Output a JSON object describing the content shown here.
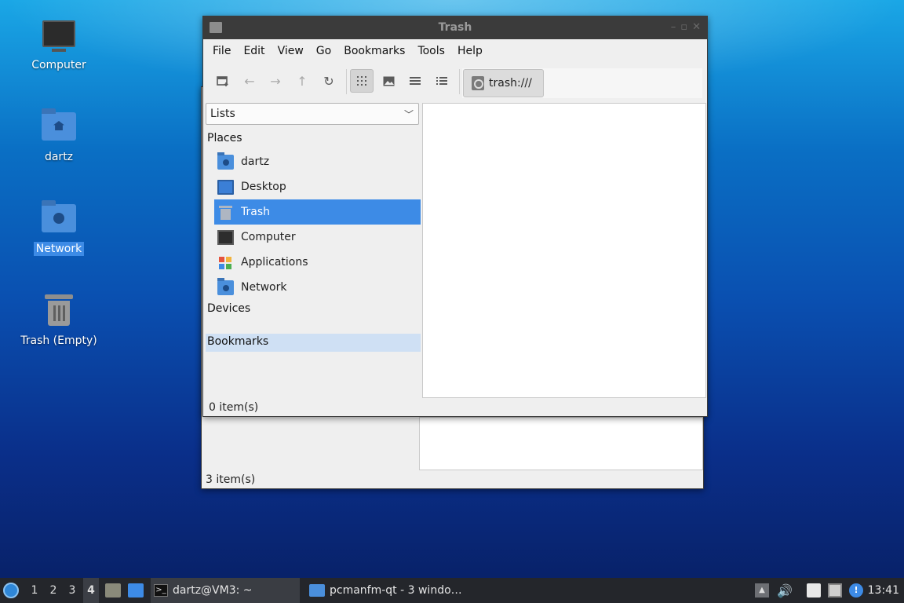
{
  "desktop": {
    "icons": [
      {
        "label": "Computer",
        "icon": "computer-icon"
      },
      {
        "label": "dartz",
        "icon": "home-folder-icon"
      },
      {
        "label": "Network",
        "icon": "network-folder-icon"
      },
      {
        "label": "Trash (Empty)",
        "icon": "trash-icon"
      }
    ]
  },
  "back_window": {
    "status": "3 item(s)"
  },
  "window": {
    "title": "Trash",
    "menu": [
      "File",
      "Edit",
      "View",
      "Go",
      "Bookmarks",
      "Tools",
      "Help"
    ],
    "toolbar": {
      "icons": [
        "new-tab-icon",
        "back-arrow-icon",
        "forward-arrow-icon",
        "up-arrow-icon",
        "reload-icon",
        "icon-view-icon",
        "thumbnail-view-icon",
        "compact-view-icon",
        "detailed-list-icon"
      ],
      "path": "trash:///"
    },
    "sidebar": {
      "combo_value": "Lists",
      "places_heading": "Places",
      "places": [
        {
          "label": "dartz",
          "icon": "home-folder-icon"
        },
        {
          "label": "Desktop",
          "icon": "desktop-icon"
        },
        {
          "label": "Trash",
          "icon": "trash-icon",
          "selected": true
        },
        {
          "label": "Computer",
          "icon": "computer-icon"
        },
        {
          "label": "Applications",
          "icon": "applications-icon"
        },
        {
          "label": "Network",
          "icon": "network-folder-icon"
        }
      ],
      "devices_heading": "Devices",
      "bookmarks_heading": "Bookmarks"
    },
    "status": "0 item(s)"
  },
  "taskbar": {
    "workspaces": [
      "1",
      "2",
      "3",
      "4"
    ],
    "current_workspace": "4",
    "tasks": [
      {
        "label": "dartz@VM3: ~",
        "icon": "terminal-icon"
      },
      {
        "label": "pcmanfm-qt - 3 windo…",
        "icon": "folder-icon"
      }
    ],
    "clock": "13:41"
  },
  "colors": {
    "selection": "#3d8be6",
    "taskbar": "#24262b",
    "titlebar": "#3b3b3b"
  }
}
